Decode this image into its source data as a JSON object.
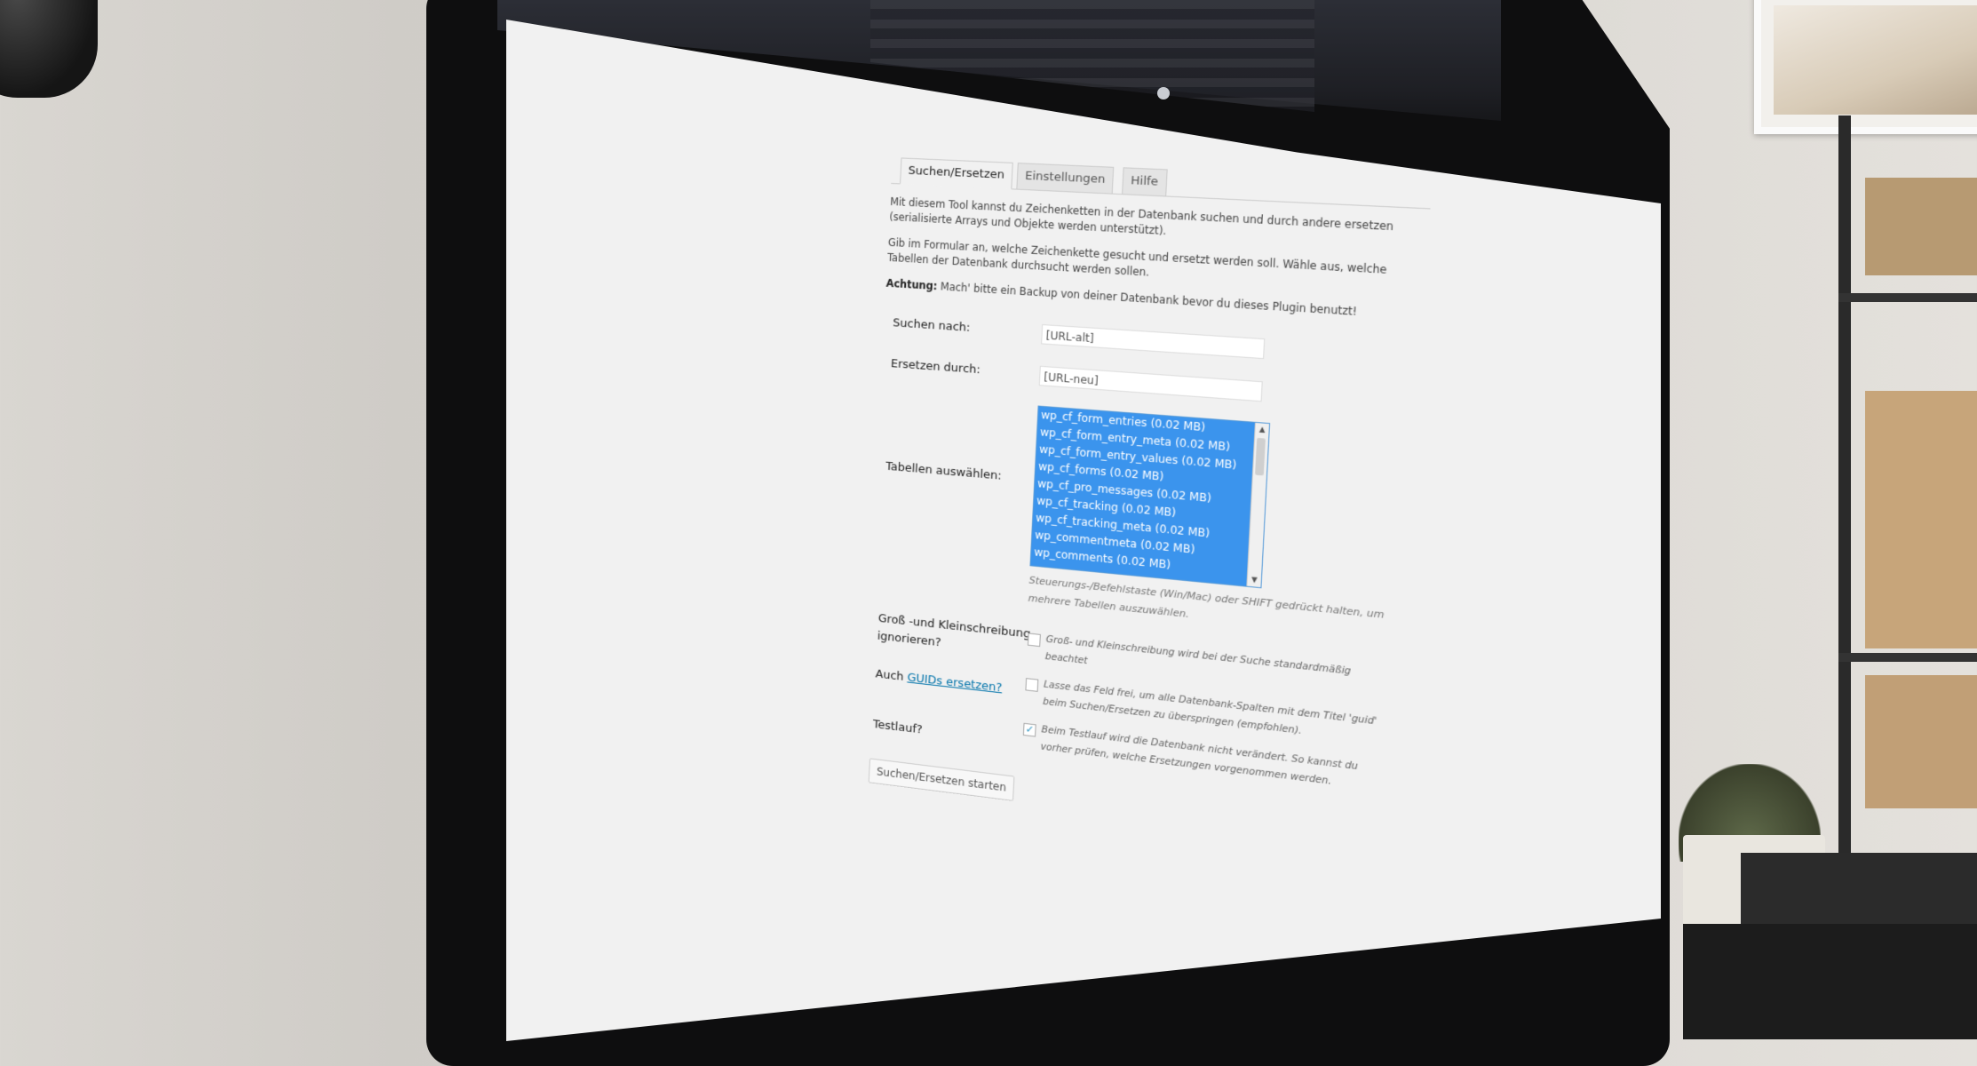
{
  "tabs": [
    {
      "label": "Suchen/Ersetzen",
      "active": true
    },
    {
      "label": "Einstellungen",
      "active": false
    },
    {
      "label": "Hilfe",
      "active": false
    }
  ],
  "intro": {
    "p1": "Mit diesem Tool kannst du Zeichenketten in der Datenbank suchen und durch andere ersetzen (serialisierte Arrays und Objekte werden unterstützt).",
    "p2": "Gib im Formular an, welche Zeichenkette gesucht und ersetzt werden soll. Wähle aus, welche Tabellen der Datenbank durchsucht werden sollen.",
    "warning_label": "Achtung:",
    "warning_text": "Mach' bitte ein Backup von deiner Datenbank bevor du dieses Plugin benutzt!"
  },
  "form": {
    "search_label": "Suchen nach:",
    "search_value": "[URL-alt]",
    "replace_label": "Ersetzen durch:",
    "replace_value": "[URL-neu]",
    "tables_label": "Tabellen auswählen:",
    "tables": [
      "wp_cf_form_entries (0.02 MB)",
      "wp_cf_form_entry_meta (0.02 MB)",
      "wp_cf_form_entry_values (0.02 MB)",
      "wp_cf_forms (0.02 MB)",
      "wp_cf_pro_messages (0.02 MB)",
      "wp_cf_tracking (0.02 MB)",
      "wp_cf_tracking_meta (0.02 MB)",
      "wp_commentmeta (0.02 MB)",
      "wp_comments (0.02 MB)"
    ],
    "tables_hint": "Steuerungs-/Befehlstaste (Win/Mac) oder SHIFT gedrückt halten, um mehrere Tabellen auszuwählen.",
    "case_label_1": "Groß -und Kleinschreibung",
    "case_label_2": "ignorieren?",
    "case_text": "Groß- und Kleinschreibung wird bei der Suche standardmäßig beachtet",
    "case_checked": false,
    "guid_label_prefix": "Auch",
    "guid_label_link": "GUIDs ersetzen?",
    "guid_text": "Lasse das Feld frei, um alle Datenbank-Spalten mit dem Titel 'guid' beim Suchen/Ersetzen zu überspringen (empfohlen).",
    "guid_checked": false,
    "dry_label": "Testlauf?",
    "dry_text": "Beim Testlauf wird die Datenbank nicht verändert. So kannst du vorher prüfen, welche Ersetzungen vorgenommen werden.",
    "dry_checked": true,
    "check_mark": "✓",
    "submit_label": "Suchen/Ersetzen starten"
  }
}
